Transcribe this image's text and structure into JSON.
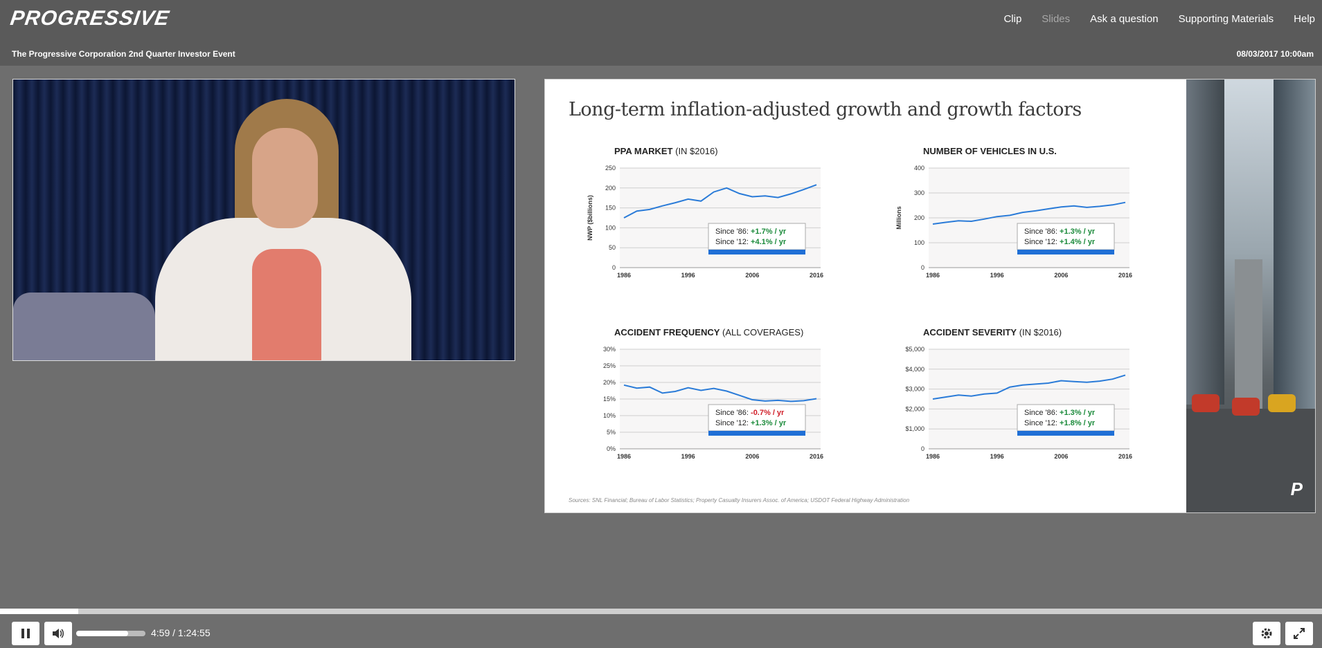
{
  "header": {
    "logo_text": "PROGRESSIVE",
    "nav": [
      "Clip",
      "Slides",
      "Ask a question",
      "Supporting Materials",
      "Help"
    ],
    "event_title": "The Progressive Corporation 2nd Quarter Investor Event",
    "event_datetime": "08/03/2017 10:00am"
  },
  "slide": {
    "title": "Long-term inflation-adjusted growth and growth factors",
    "sources": "Sources: SNL Financial; Bureau of Labor Statistics; Property Casualty Insurers Assoc. of America; USDOT Federal Highway Administration",
    "brand_mark": "P"
  },
  "chart_data": [
    {
      "type": "line",
      "title": "PPA MARKET",
      "title_suffix": "(IN $2016)",
      "ylabel": "NWP ($billions)",
      "ylim": [
        0,
        250
      ],
      "yticks": [
        "250",
        "200",
        "150",
        "100",
        "50",
        "0"
      ],
      "xticks": [
        "1986",
        "1996",
        "2006",
        "2016"
      ],
      "x": [
        1986,
        1988,
        1990,
        1992,
        1994,
        1996,
        1998,
        2000,
        2002,
        2004,
        2006,
        2008,
        2010,
        2012,
        2014,
        2016
      ],
      "values": [
        125,
        142,
        146,
        155,
        163,
        172,
        167,
        190,
        200,
        186,
        178,
        180,
        176,
        185,
        196,
        208
      ],
      "annotation": [
        {
          "label": "Since '86: ",
          "value": "+1.7% / yr",
          "color": "#1a8a3a"
        },
        {
          "label": "Since '12: ",
          "value": "+4.1% / yr",
          "color": "#1a8a3a"
        }
      ]
    },
    {
      "type": "line",
      "title": "NUMBER OF VEHICLES IN U.S.",
      "title_suffix": "",
      "ylabel": "Millions",
      "ylim": [
        0,
        400
      ],
      "yticks": [
        "400",
        "300",
        "200",
        "100",
        "0"
      ],
      "xticks": [
        "1986",
        "1996",
        "2006",
        "2016"
      ],
      "x": [
        1986,
        1988,
        1990,
        1992,
        1994,
        1996,
        1998,
        2000,
        2002,
        2004,
        2006,
        2008,
        2010,
        2012,
        2014,
        2016
      ],
      "values": [
        175,
        182,
        188,
        186,
        195,
        205,
        210,
        222,
        228,
        236,
        244,
        248,
        242,
        246,
        252,
        262
      ],
      "annotation": [
        {
          "label": "Since '86: ",
          "value": "+1.3% / yr",
          "color": "#1a8a3a"
        },
        {
          "label": "Since '12: ",
          "value": "+1.4% / yr",
          "color": "#1a8a3a"
        }
      ]
    },
    {
      "type": "line",
      "title": "ACCIDENT FREQUENCY",
      "title_suffix": "(ALL COVERAGES)",
      "ylabel": "",
      "ylim": [
        0,
        30
      ],
      "yticks": [
        "30%",
        "25%",
        "20%",
        "15%",
        "10%",
        "5%",
        "0%"
      ],
      "xticks": [
        "1986",
        "1996",
        "2006",
        "2016"
      ],
      "x": [
        1986,
        1988,
        1990,
        1992,
        1994,
        1996,
        1998,
        2000,
        2002,
        2004,
        2006,
        2008,
        2010,
        2012,
        2014,
        2016
      ],
      "values": [
        19.2,
        18.3,
        18.6,
        16.8,
        17.3,
        18.4,
        17.6,
        18.2,
        17.4,
        16.1,
        14.8,
        14.4,
        14.6,
        14.3,
        14.5,
        15.1
      ],
      "annotation": [
        {
          "label": "Since '86: ",
          "value": "-0.7% / yr",
          "color": "#d0202a"
        },
        {
          "label": "Since '12: ",
          "value": "+1.3% / yr",
          "color": "#1a8a3a"
        }
      ]
    },
    {
      "type": "line",
      "title": "ACCIDENT SEVERITY",
      "title_suffix": "(IN $2016)",
      "ylabel": "",
      "ylim": [
        0,
        5000
      ],
      "yticks": [
        "$5,000",
        "$4,000",
        "$3,000",
        "$2,000",
        "$1,000",
        "0"
      ],
      "xticks": [
        "1986",
        "1996",
        "2006",
        "2016"
      ],
      "x": [
        1986,
        1988,
        1990,
        1992,
        1994,
        1996,
        1998,
        2000,
        2002,
        2004,
        2006,
        2008,
        2010,
        2012,
        2014,
        2016
      ],
      "values": [
        2500,
        2600,
        2700,
        2650,
        2750,
        2800,
        3100,
        3200,
        3250,
        3300,
        3420,
        3380,
        3340,
        3400,
        3500,
        3700
      ],
      "annotation": [
        {
          "label": "Since '86: ",
          "value": "+1.3% / yr",
          "color": "#1a8a3a"
        },
        {
          "label": "Since '12: ",
          "value": "+1.8% / yr",
          "color": "#1a8a3a"
        }
      ]
    }
  ],
  "player": {
    "progress_fraction": 0.059,
    "volume_fraction": 0.75,
    "timecode": "4:59 / 1:24:55",
    "pause_icon": "pause-icon",
    "volume_icon": "volume-icon",
    "settings_icon": "gear-icon",
    "fullscreen_icon": "fullscreen-icon"
  }
}
